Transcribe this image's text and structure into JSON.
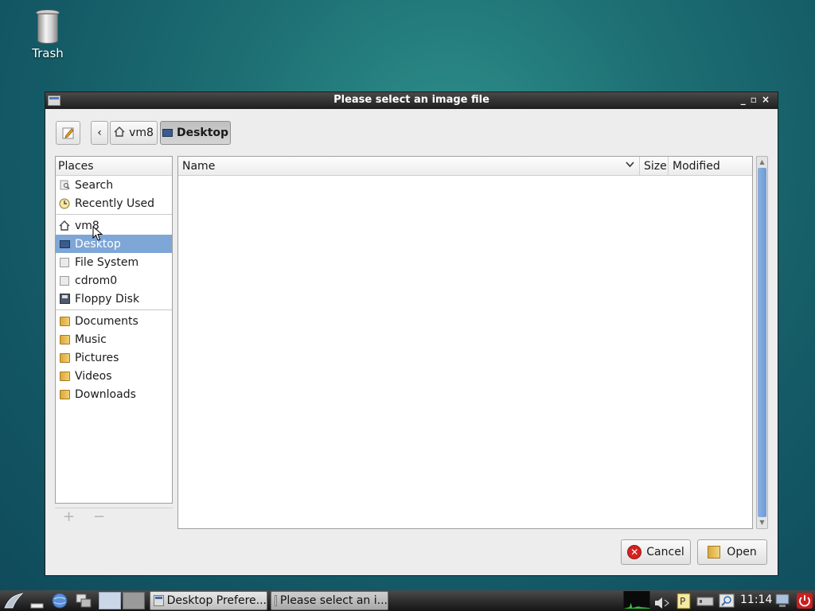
{
  "desktop": {
    "trash_label": "Trash"
  },
  "dialog": {
    "title": "Please select an image file",
    "title_controls": [
      "_",
      "▫",
      "×"
    ],
    "breadcrumb": {
      "back": "‹",
      "home": "vm8",
      "current": "Desktop"
    },
    "places_header": "Places",
    "places": [
      {
        "label": "Search",
        "icon": "search-icon"
      },
      {
        "label": "Recently Used",
        "icon": "clock-icon"
      },
      {
        "label": "vm8",
        "icon": "home-icon"
      },
      {
        "label": "Desktop",
        "icon": "desktop-icon",
        "selected": true
      },
      {
        "label": "File System",
        "icon": "drive-icon"
      },
      {
        "label": "cdrom0",
        "icon": "drive-icon"
      },
      {
        "label": "Floppy Disk",
        "icon": "floppy-icon"
      },
      {
        "label": "Documents",
        "icon": "folder-icon"
      },
      {
        "label": "Music",
        "icon": "folder-icon"
      },
      {
        "label": "Pictures",
        "icon": "folder-icon"
      },
      {
        "label": "Videos",
        "icon": "folder-icon"
      },
      {
        "label": "Downloads",
        "icon": "folder-icon"
      }
    ],
    "places_footer": {
      "add": "+",
      "remove": "−"
    },
    "columns": {
      "name": "Name",
      "size": "Size",
      "modified": "Modified"
    },
    "buttons": {
      "cancel": "Cancel",
      "open": "Open"
    }
  },
  "taskbar": {
    "tasks": [
      "Desktop Prefere...",
      "Please select an i..."
    ],
    "clock": "11:14"
  },
  "colors": {
    "selection": "#7ea6d6",
    "titlebar": "#1e1e1e",
    "desktop": "#1d6f73"
  }
}
